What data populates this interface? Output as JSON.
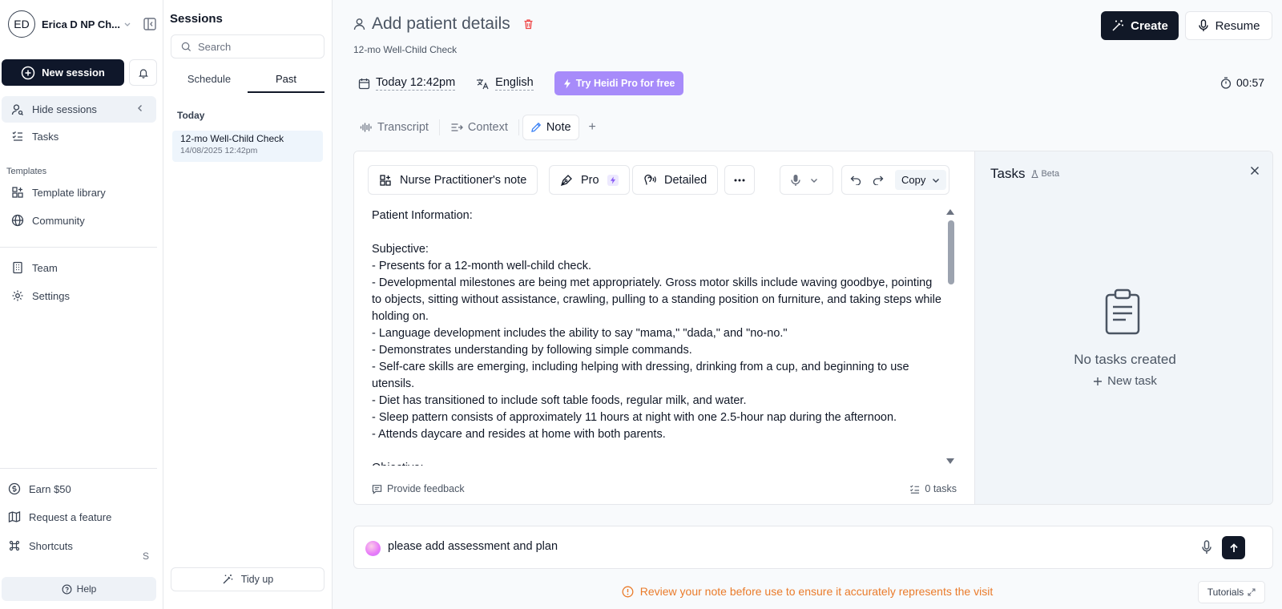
{
  "nav": {
    "avatar_initials": "ED",
    "user_name": "Erica D NP Ch...",
    "new_session": "New session",
    "hide_sessions": "Hide sessions",
    "tasks": "Tasks",
    "templates_section": "Templates",
    "template_library": "Template library",
    "community": "Community",
    "team": "Team",
    "settings": "Settings",
    "earn": "Earn $50",
    "request_feature": "Request a feature",
    "shortcuts": "Shortcuts",
    "shortcuts_key": "S",
    "help": "Help"
  },
  "sessions": {
    "title": "Sessions",
    "search_placeholder": "Search",
    "tabs": [
      "Schedule",
      "Past"
    ],
    "active_tab": "Past",
    "group_label": "Today",
    "items": [
      {
        "title": "12-mo Well-Child Check",
        "date": "14/08/2025 12:42pm"
      }
    ],
    "tidy_up": "Tidy up"
  },
  "header": {
    "title": "Add patient details",
    "subtitle": "12-mo Well-Child Check",
    "create": "Create",
    "resume": "Resume",
    "datetime": "Today 12:42pm",
    "language": "English",
    "pro_cta": "Try Heidi Pro for free",
    "timer": "00:57"
  },
  "tabs": {
    "transcript": "Transcript",
    "context": "Context",
    "note": "Note",
    "add": "+"
  },
  "note_toolbar": {
    "template": "Nurse Practitioner's note",
    "pro": "Pro",
    "detail": "Detailed",
    "copy": "Copy"
  },
  "note": {
    "lines": [
      "Patient Information:",
      "",
      "Subjective:",
      "- Presents for a 12-month well-child check.",
      "- Developmental milestones are being met appropriately. Gross motor skills include waving goodbye, pointing to objects, sitting without assistance, crawling, pulling to a standing position on furniture, and taking steps while holding on.",
      "- Language development includes the ability to say \"mama,\" \"dada,\" and \"no-no.\"",
      "- Demonstrates understanding by following simple commands.",
      "- Self-care skills are emerging, including helping with dressing, drinking from a cup, and beginning to use utensils.",
      "- Diet has transitioned to include soft table foods, regular milk, and water.",
      "- Sleep pattern consists of approximately 11 hours at night with one 2.5-hour nap during the afternoon.",
      "- Attends daycare and resides at home with both parents.",
      "",
      "Objective:"
    ],
    "feedback": "Provide feedback",
    "tasks_count": "0 tasks"
  },
  "tasks_panel": {
    "title": "Tasks",
    "badge": "Beta",
    "empty": "No tasks created",
    "new_task": "New task"
  },
  "chat": {
    "input_value": "please add assessment and plan"
  },
  "footer": {
    "warning": "Review your note before use to ensure it accurately represents the visit",
    "tutorials": "Tutorials"
  },
  "colors": {
    "primary": "#111827",
    "pro_accent": "#a78bfa",
    "warning": "#ea7b2a",
    "delete": "#ef4444"
  }
}
